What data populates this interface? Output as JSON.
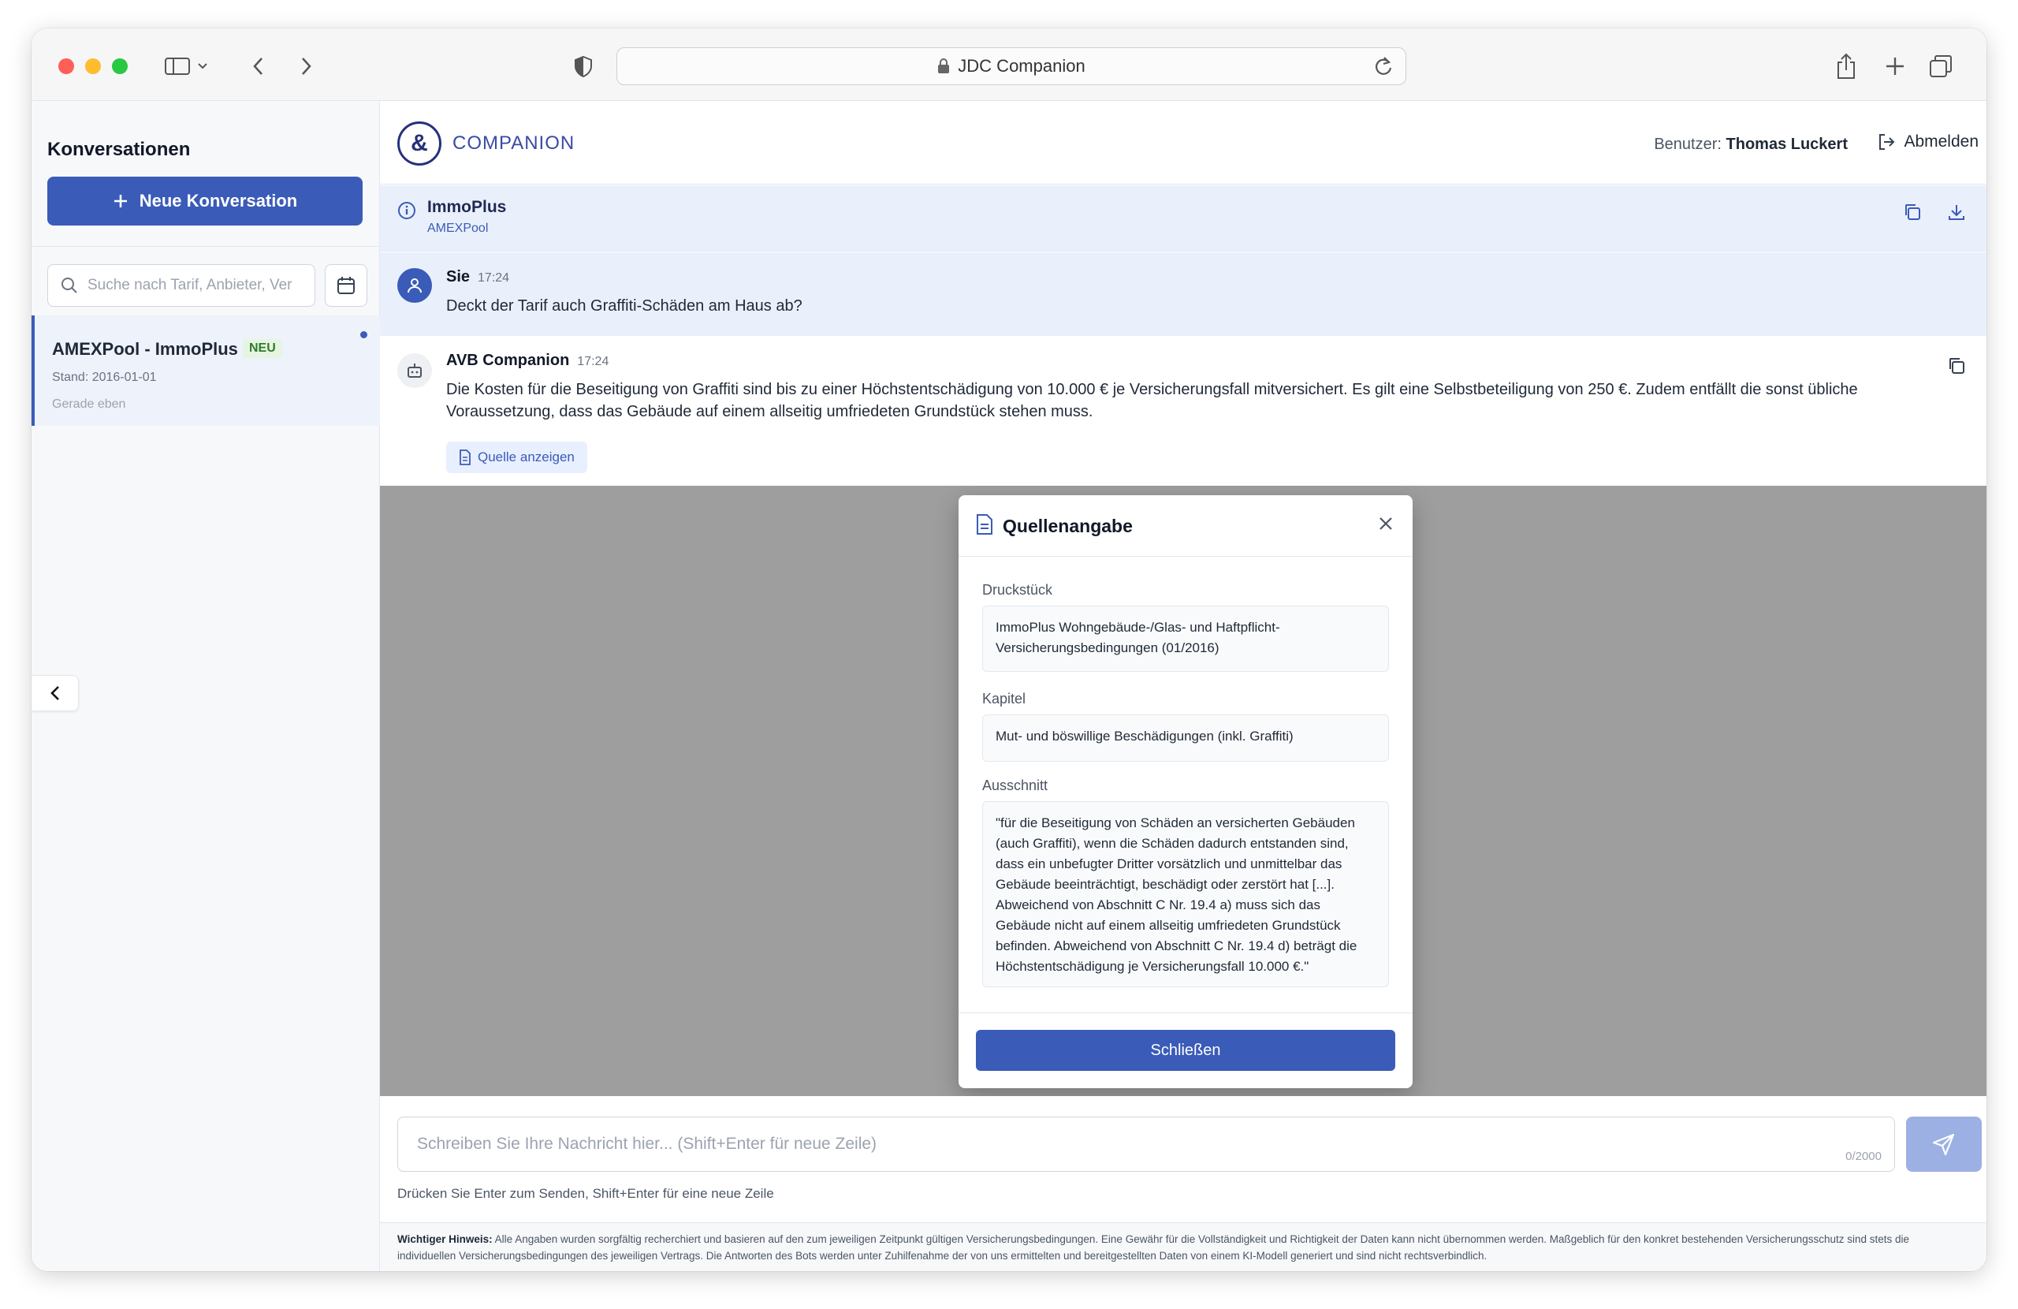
{
  "browser": {
    "address": "JDC Companion"
  },
  "sidebar": {
    "title": "Konversationen",
    "new_button": "Neue Konversation",
    "search_placeholder": "Suche nach Tarif, Anbieter, Ver",
    "conversations": [
      {
        "name": "AMEXPool - ImmoPlus",
        "badge": "NEU",
        "date": "Stand: 2016-01-01",
        "time": "Gerade eben"
      }
    ]
  },
  "header": {
    "brand": "COMPANION",
    "user_label": "Benutzer:",
    "user_name": "Thomas Luckert",
    "logout": "Abmelden"
  },
  "info": {
    "title": "ImmoPlus",
    "subtitle": "AMEXPool"
  },
  "messages": [
    {
      "sender": "Sie",
      "time": "17:24",
      "text": "Deckt der Tarif auch Graffiti-Schäden am Haus ab?"
    },
    {
      "sender": "AVB Companion",
      "time": "17:24",
      "text": "Die Kosten für die Beseitigung von Graffiti sind bis zu einer Höchstentschädigung von 10.000 € je Versicherungsfall mitversichert. Es gilt eine Selbstbeteiligung von 250 €. Zudem entfällt die sonst übliche Voraussetzung, dass das Gebäude auf einem allseitig umfriedeten Grundstück stehen muss.",
      "source_button": "Quelle anzeigen"
    }
  ],
  "modal": {
    "title": "Quellenangabe",
    "druckstueck_label": "Druckstück",
    "druckstueck_value": "ImmoPlus Wohngebäude-/Glas- und Haftpflicht-Versicherungsbedingungen (01/2016)",
    "kapitel_label": "Kapitel",
    "kapitel_value": "Mut- und böswillige Beschädigungen (inkl. Graffiti)",
    "ausschnitt_label": "Ausschnitt",
    "ausschnitt_value": "\"für die Beseitigung von Schäden an versicherten Gebäuden (auch Graffiti), wenn die Schäden dadurch entstanden sind, dass ein unbefugter Dritter vorsätzlich und unmittelbar das Gebäude beeinträchtigt, beschädigt oder zerstört hat [...]. Abweichend von Abschnitt C Nr. 19.4 a) muss sich das Gebäude nicht auf einem allseitig umfriedeten Grundstück befinden. Abweichend von Abschnitt C Nr. 19.4 d) beträgt die Höchstentschädigung je Versicherungsfall 10.000 €.\"",
    "close_button": "Schließen"
  },
  "composer": {
    "placeholder": "Schreiben Sie Ihre Nachricht hier... (Shift+Enter für neue Zeile)",
    "counter": "0/2000",
    "hint": "Drücken Sie Enter zum Senden, Shift+Enter für eine neue Zeile"
  },
  "disclaimer": {
    "label": "Wichtiger Hinweis:",
    "text": "Alle Angaben wurden sorgfältig recherchiert und basieren auf den zum jeweiligen Zeitpunkt gültigen Versicherungsbedingungen. Eine Gewähr für die Vollständigkeit und Richtigkeit der Daten kann nicht übernommen werden. Maßgeblich für den konkret bestehenden Versicherungsschutz sind stets die individuellen Versicherungsbedingungen des jeweiligen Vertrags. Die Antworten des Bots werden unter Zuhilfenahme der von uns ermittelten und bereitgestellten Daten von einem KI-Modell generiert und sind nicht rechtsverbindlich."
  },
  "colors": {
    "accent": "#3a5bb8",
    "brand": "#27307a",
    "overlay": "#9e9e9e"
  }
}
